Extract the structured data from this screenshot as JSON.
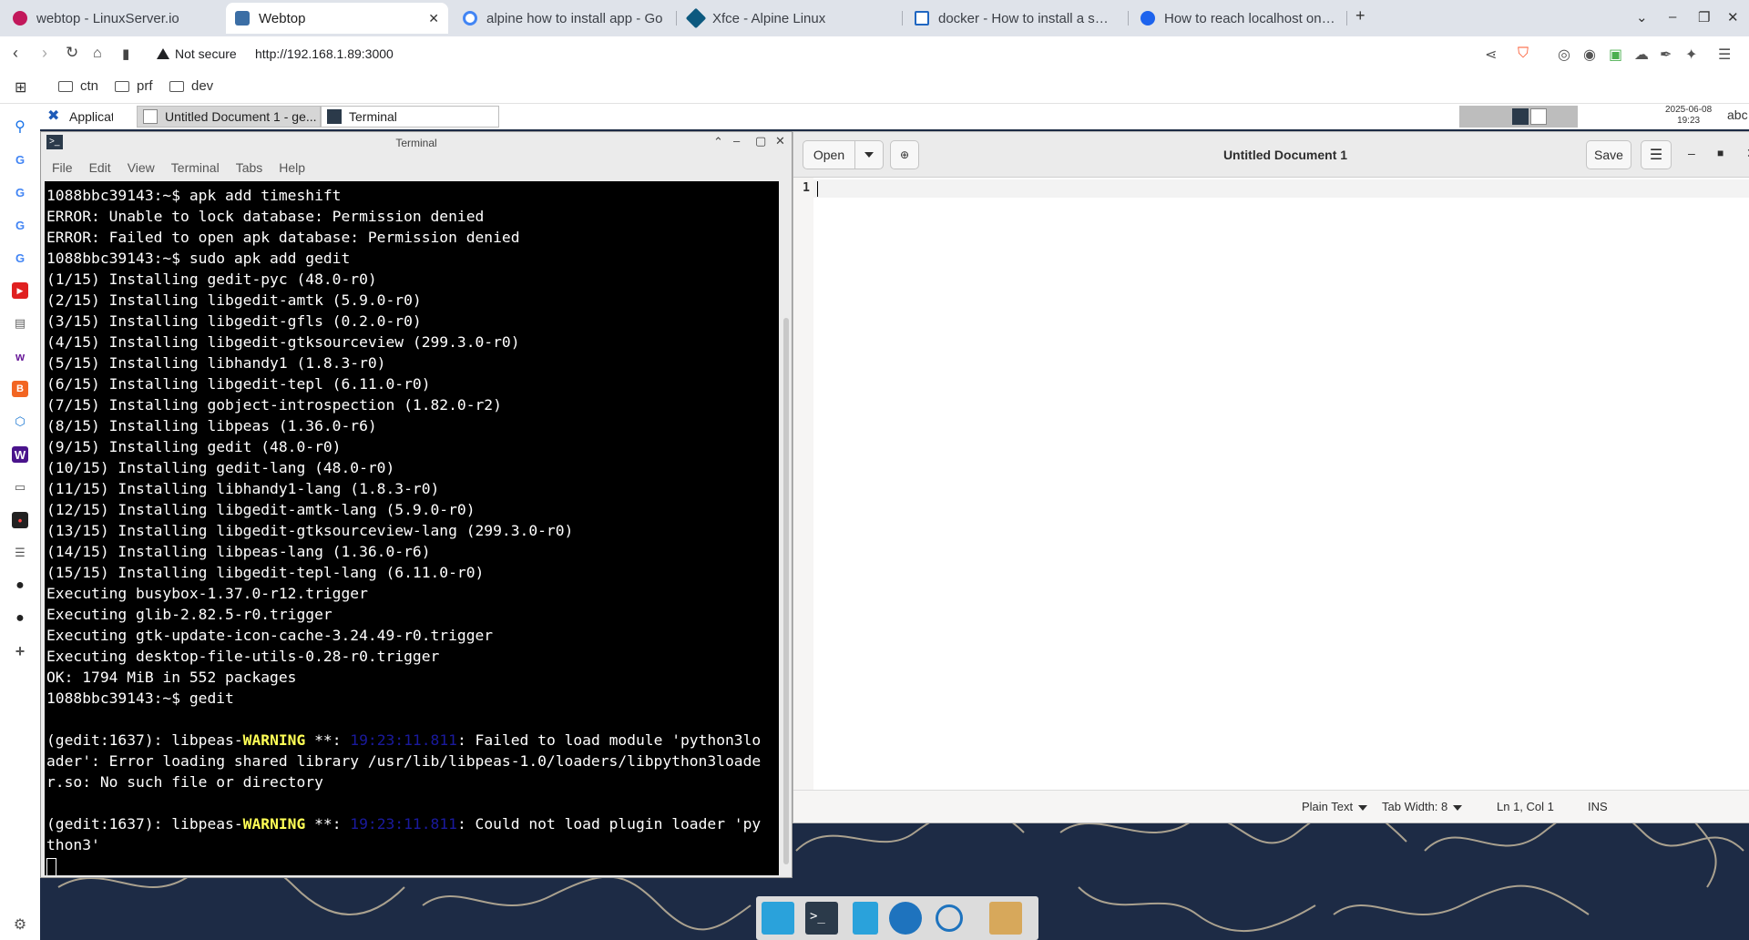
{
  "browser": {
    "tabs": [
      {
        "title": "webtop - LinuxServer.io",
        "color": "#c2185b"
      },
      {
        "title": "Webtop",
        "color": "#3b6ea5",
        "close": "✕"
      },
      {
        "title": "alpine how to install app - Go",
        "color": "#4285f4"
      },
      {
        "title": "Xfce - Alpine Linux",
        "color": "#0d597f"
      },
      {
        "title": "docker - How to install a spec",
        "color": "#1f66c1"
      },
      {
        "title": "How to reach localhost on ho",
        "color": "#1d63ed"
      }
    ],
    "new_tab": "+",
    "address": {
      "security": "Not secure",
      "url": "http://192.168.1.89:3000"
    },
    "bookmarks": [
      {
        "label": "ctn"
      },
      {
        "label": "prf"
      },
      {
        "label": "dev"
      }
    ]
  },
  "xfce_panel": {
    "applications": "Applications",
    "windows": [
      "Untitled Document 1 - ge...",
      "Terminal"
    ],
    "clock": {
      "date": "2025-06-08",
      "time": "19:23"
    },
    "keyboard": "abc"
  },
  "terminal": {
    "title": "Terminal",
    "menu": [
      "File",
      "Edit",
      "View",
      "Terminal",
      "Tabs",
      "Help"
    ],
    "lines": [
      "1088bbc39143:~$ apk add timeshift",
      "ERROR: Unable to lock database: Permission denied",
      "ERROR: Failed to open apk database: Permission denied",
      "1088bbc39143:~$ sudo apk add gedit",
      "(1/15) Installing gedit-pyc (48.0-r0)",
      "(2/15) Installing libgedit-amtk (5.9.0-r0)",
      "(3/15) Installing libgedit-gfls (0.2.0-r0)",
      "(4/15) Installing libgedit-gtksourceview (299.3.0-r0)",
      "(5/15) Installing libhandy1 (1.8.3-r0)",
      "(6/15) Installing libgedit-tepl (6.11.0-r0)",
      "(7/15) Installing gobject-introspection (1.82.0-r2)",
      "(8/15) Installing libpeas (1.36.0-r6)",
      "(9/15) Installing gedit (48.0-r0)",
      "(10/15) Installing gedit-lang (48.0-r0)",
      "(11/15) Installing libhandy1-lang (1.8.3-r0)",
      "(12/15) Installing libgedit-amtk-lang (5.9.0-r0)",
      "(13/15) Installing libgedit-gtksourceview-lang (299.3.0-r0)",
      "(14/15) Installing libpeas-lang (1.36.0-r6)",
      "(15/15) Installing libgedit-tepl-lang (6.11.0-r0)",
      "Executing busybox-1.37.0-r12.trigger",
      "Executing glib-2.82.5-r0.trigger",
      "Executing gtk-update-icon-cache-3.24.49-r0.trigger",
      "Executing desktop-file-utils-0.28-r0.trigger",
      "OK: 1794 MiB in 552 packages",
      "1088bbc39143:~$ gedit"
    ],
    "warn1": {
      "prefix": "(gedit:1637): libpeas-",
      "level": "WARNING",
      "mid": " **: ",
      "time": "19:23:11.811",
      "rest": ": Failed to load module 'python3lo",
      "cont1": "ader': Error loading shared library /usr/lib/libpeas-1.0/loaders/libpython3loade",
      "cont2": "r.so: No such file or directory"
    },
    "warn2": {
      "prefix": "(gedit:1637): libpeas-",
      "level": "WARNING",
      "mid": " **: ",
      "time": "19:23:11.811",
      "rest": ": Could not load plugin loader 'py",
      "cont1": "thon3'"
    }
  },
  "gedit": {
    "open_label": "Open",
    "title": "Untitled Document 1",
    "save_label": "Save",
    "line_number": "1",
    "status": {
      "language": "Plain Text",
      "tab_width": "Tab Width: 8",
      "position": "Ln 1, Col 1",
      "mode": "INS"
    }
  }
}
